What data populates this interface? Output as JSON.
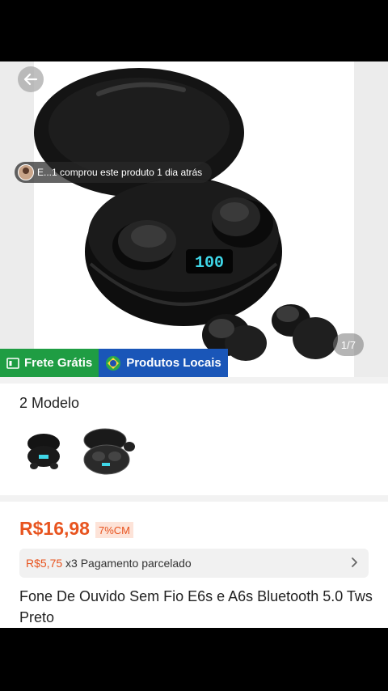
{
  "gallery": {
    "buyer_toast": "E...1 comprou este produto 1 dia atrás",
    "counter": "1/7",
    "badges": {
      "free_shipping": "Frete Grátis",
      "local_products": "Produtos Locais"
    }
  },
  "model": {
    "title": "2 Modelo"
  },
  "price": {
    "current": "R$16,98",
    "discount": "7%CM",
    "installment_amount": "R$5,75",
    "installment_text": "x3 Pagamento parcelado"
  },
  "product": {
    "title": "Fone De Ouvido Sem Fio E6s e A6s Bluetooth 5.0 Tws Preto"
  },
  "colors": {
    "price_accent": "#e8541f",
    "badge_green": "#1f9d43",
    "badge_blue": "#1a56b8"
  }
}
